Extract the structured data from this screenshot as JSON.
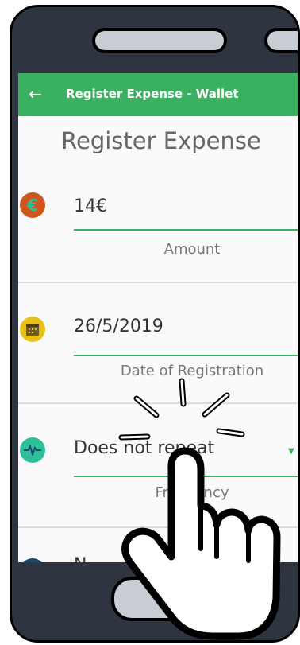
{
  "appbar": {
    "back_icon": "arrow-left-icon",
    "title": "Register Expense - Wallet"
  },
  "page": {
    "title": "Register Expense"
  },
  "fields": {
    "amount": {
      "value": "14€",
      "label": "Amount",
      "icon": "euro-icon",
      "color": "#d0561e"
    },
    "date": {
      "value": "26/5/2019",
      "label": "Date of Registration",
      "icon": "calendar-icon",
      "color": "#e8c21a"
    },
    "frequency": {
      "value": "Does not repeat",
      "label": "Frequency",
      "icon": "pulse-icon",
      "color": "#2ebf9a"
    },
    "next_partial": {
      "value": "N"
    }
  },
  "overlay": {
    "icon": "hand-pointer-icon"
  },
  "colors": {
    "accent": "#3ab160",
    "phone": "#2e3440"
  }
}
